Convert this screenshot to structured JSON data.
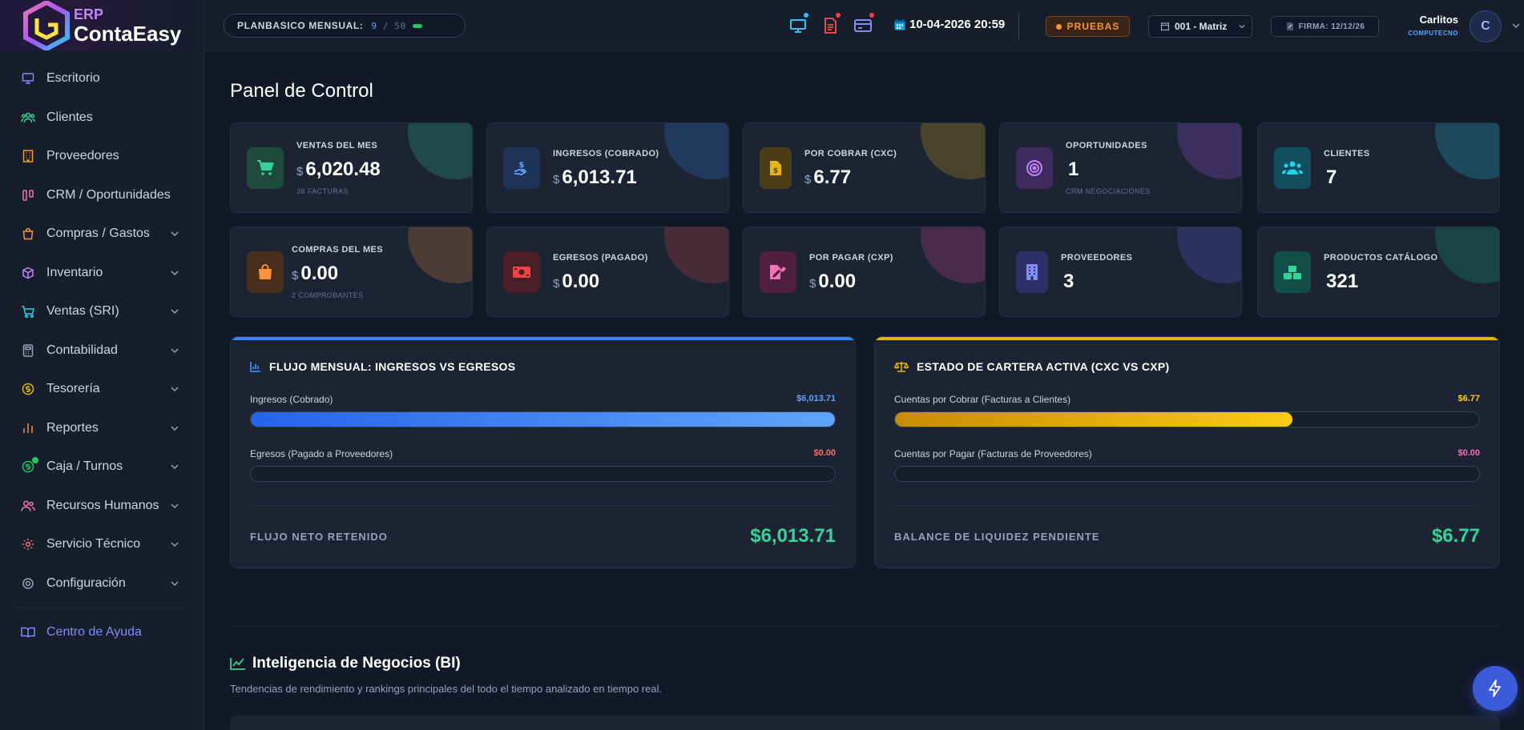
{
  "brand": {
    "erp": "ERP",
    "name": "ContaEasy"
  },
  "sidebar": {
    "items": [
      {
        "label": "Escritorio"
      },
      {
        "label": "Clientes"
      },
      {
        "label": "Proveedores"
      },
      {
        "label": "CRM / Oportunidades"
      },
      {
        "label": "Compras / Gastos"
      },
      {
        "label": "Inventario"
      },
      {
        "label": "Ventas (SRI)"
      },
      {
        "label": "Contabilidad"
      },
      {
        "label": "Tesorería"
      },
      {
        "label": "Reportes"
      },
      {
        "label": "Caja / Turnos"
      },
      {
        "label": "Recursos Humanos"
      },
      {
        "label": "Servicio Técnico"
      },
      {
        "label": "Configuración"
      }
    ],
    "help": "Centro de Ayuda"
  },
  "topbar": {
    "plan_label": "PLANBASICO MENSUAL:",
    "plan_used": "9",
    "plan_total": "/ 50",
    "datetime": "10-04-2026 20:59",
    "env_badge": "PRUEBAS",
    "branch": "001 - Matriz",
    "firma": "FIRMA: 12/12/26",
    "user_name": "Carlitos",
    "user_company": "COMPUTECNO",
    "avatar_initial": "C"
  },
  "page": {
    "title": "Panel de Control"
  },
  "cards": [
    {
      "caption": "VENTAS DEL MES",
      "currency": "$",
      "value": "6,020.48",
      "sub": "38 FACTURAS"
    },
    {
      "caption": "INGRESOS (COBRADO)",
      "currency": "$",
      "value": "6,013.71",
      "sub": ""
    },
    {
      "caption": "POR COBRAR (CXC)",
      "currency": "$",
      "value": "6.77",
      "sub": ""
    },
    {
      "caption": "OPORTUNIDADES",
      "currency": "",
      "value": "1",
      "sub": "CRM NEGOCIACIONES"
    },
    {
      "caption": "CLIENTES",
      "currency": "",
      "value": "7",
      "sub": ""
    },
    {
      "caption": "COMPRAS DEL MES",
      "currency": "$",
      "value": "0.00",
      "sub": "2 COMPROBANTES"
    },
    {
      "caption": "EGRESOS (PAGADO)",
      "currency": "$",
      "value": "0.00",
      "sub": ""
    },
    {
      "caption": "POR PAGAR (CXP)",
      "currency": "$",
      "value": "0.00",
      "sub": ""
    },
    {
      "caption": "PROVEEDORES",
      "currency": "",
      "value": "3",
      "sub": ""
    },
    {
      "caption": "PRODUCTOS CATÁLOGO",
      "currency": "",
      "value": "321",
      "sub": ""
    }
  ],
  "flujo": {
    "title": "FLUJO MENSUAL: INGRESOS VS EGRESOS",
    "row1_label": "Ingresos (Cobrado)",
    "row1_value": "$6,013.71",
    "row1_fill": 1.0,
    "row2_label": "Egresos (Pagado a Proveedores)",
    "row2_value": "$0.00",
    "row2_fill": 0.0,
    "footer_label": "FLUJO NETO RETENIDO",
    "footer_value": "$6,013.71",
    "accent": "#3b82f6"
  },
  "cartera": {
    "title": "ESTADO DE CARTERA ACTIVA (CXC VS CXP)",
    "row1_label": "Cuentas por Cobrar (Facturas a Clientes)",
    "row1_value": "$6.77",
    "row1_fill": 0.68,
    "row2_label": "Cuentas por Pagar (Facturas de Proveedores)",
    "row2_value": "$0.00",
    "row2_fill": 0.0,
    "footer_label": "BALANCE DE LIQUIDEZ PENDIENTE",
    "footer_value": "$6.77",
    "accent": "#eab308"
  },
  "bi": {
    "title": "Inteligencia de Negocios (BI)",
    "subtitle": "Tendencias de rendimiento y rankings principales del todo el tiempo analizado en tiempo real."
  }
}
